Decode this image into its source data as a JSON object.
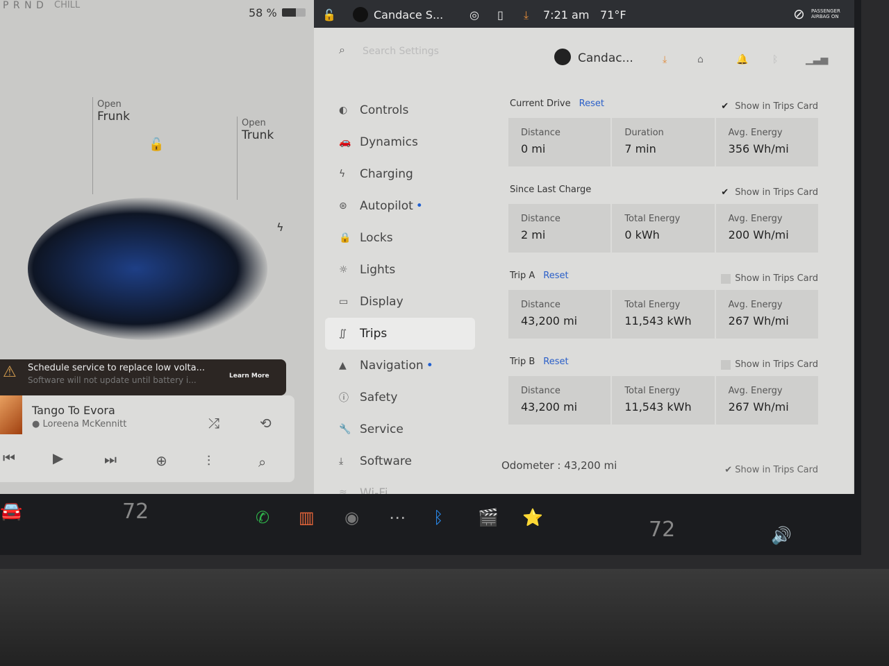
{
  "left": {
    "gear": "P R N D",
    "drive_mode": "CHILL",
    "battery_percent": "58 %",
    "battery_level": 0.58,
    "frunk": {
      "action": "Open",
      "label": "Frunk"
    },
    "trunk": {
      "action": "Open",
      "label": "Trunk"
    },
    "alert": {
      "title": "Schedule service to replace low volta...",
      "subtitle": "Software will not update until battery i...",
      "learn_more": "Learn More"
    },
    "media": {
      "song": "Tango To Evora",
      "artist": "Loreena McKennitt"
    }
  },
  "status": {
    "profile": "Candace S...",
    "time": "7:21 am",
    "temp": "71°F",
    "airbag": "PASSENGER AIRBAG ON"
  },
  "settings": {
    "search_placeholder": "Search Settings",
    "user": "Candac...",
    "menu": [
      {
        "label": "Controls",
        "icon": "◐"
      },
      {
        "label": "Dynamics",
        "icon": "🚗"
      },
      {
        "label": "Charging",
        "icon": "ϟ"
      },
      {
        "label": "Autopilot",
        "icon": "⊛",
        "dot": "•"
      },
      {
        "label": "Locks",
        "icon": "🔒"
      },
      {
        "label": "Lights",
        "icon": "☼"
      },
      {
        "label": "Display",
        "icon": "▭"
      },
      {
        "label": "Trips",
        "icon": "∬"
      },
      {
        "label": "Navigation",
        "icon": "▲",
        "dot": "•"
      },
      {
        "label": "Safety",
        "icon": "ⓘ"
      },
      {
        "label": "Service",
        "icon": "🔧"
      },
      {
        "label": "Software",
        "icon": "⤓"
      },
      {
        "label": "Wi-Fi",
        "icon": "≋"
      }
    ],
    "selected": "Trips",
    "sections": [
      {
        "title": "Current Drive",
        "reset": "Reset",
        "show": "Show in Trips Card",
        "checked": true,
        "cards": [
          {
            "label": "Distance",
            "value": "0 mi"
          },
          {
            "label": "Duration",
            "value": "7 min"
          },
          {
            "label": "Avg. Energy",
            "value": "356 Wh/mi"
          }
        ]
      },
      {
        "title": "Since Last Charge",
        "reset": "",
        "show": "Show in Trips Card",
        "checked": true,
        "cards": [
          {
            "label": "Distance",
            "value": "2 mi"
          },
          {
            "label": "Total Energy",
            "value": "0 kWh"
          },
          {
            "label": "Avg. Energy",
            "value": "200 Wh/mi"
          }
        ]
      },
      {
        "title": "Trip A",
        "reset": "Reset",
        "show": "Show in Trips Card",
        "checked": false,
        "cards": [
          {
            "label": "Distance",
            "value": "43,200 mi"
          },
          {
            "label": "Total Energy",
            "value": "11,543 kWh"
          },
          {
            "label": "Avg. Energy",
            "value": "267 Wh/mi"
          }
        ]
      },
      {
        "title": "Trip B",
        "reset": "Reset",
        "show": "Show in Trips Card",
        "checked": false,
        "cards": [
          {
            "label": "Distance",
            "value": "43,200 mi"
          },
          {
            "label": "Total Energy",
            "value": "11,543 kWh"
          },
          {
            "label": "Avg. Energy",
            "value": "267 Wh/mi"
          }
        ]
      }
    ],
    "odometer": "Odometer :  43,200 mi",
    "odometer_show": "Show in Trips Card"
  },
  "taskbar": {
    "driver_temp": "72",
    "passenger_temp": "72"
  },
  "colors": {
    "accent": "#2a5fc8",
    "alert_icon": "#d9a050",
    "phone": "#2fb34a"
  }
}
